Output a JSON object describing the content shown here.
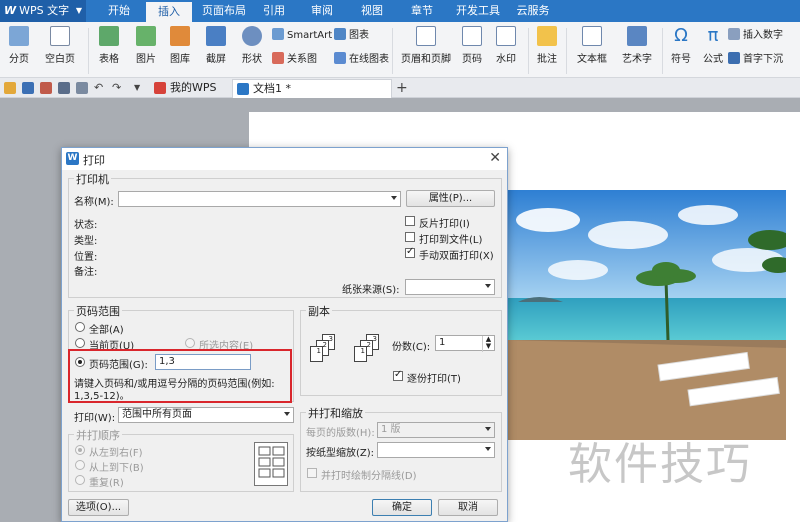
{
  "app": {
    "menu_label": "WPS 文字",
    "logo_glyph": "W",
    "tabs": [
      "开始",
      "插入",
      "页面布局",
      "引用",
      "审阅",
      "视图",
      "章节",
      "开发工具",
      "云服务"
    ],
    "active_tab": "插入"
  },
  "ribbon": {
    "page_break": "分页",
    "blank_page": "空白页",
    "table": "表格",
    "picture": "图片",
    "gallery": "图库",
    "screenshot": "截屏",
    "shapes": "形状",
    "smartart": "SmartArt",
    "chart": "图表",
    "relation": "关系图",
    "online_chart": "在线图表",
    "header_footer": "页眉和页脚",
    "page_number": "页码",
    "watermark": "水印",
    "comment": "批注",
    "textbox": "文本框",
    "wordart": "艺术字",
    "symbol": "符号",
    "formula": "公式",
    "insert_number": "插入数字",
    "drop_cap": "首字下沉"
  },
  "quickbar": {
    "doc_tabs": [
      "我的WPS",
      "文档1 *"
    ],
    "add_tab": "+"
  },
  "document": {
    "watermark_text": "软件技巧"
  },
  "dialog": {
    "title": "打印",
    "printer": {
      "legend": "打印机",
      "name_label": "名称(M):",
      "name_value": "",
      "properties_button": "属性(P)...",
      "status_label": "状态:",
      "type_label": "类型:",
      "location_label": "位置:",
      "comment_label": "备注:",
      "reverse_print": "反片打印(I)",
      "print_to_file": "打印到文件(L)",
      "manual_duplex": "手动双面打印(X)",
      "paper_source_label": "纸张来源(S):",
      "paper_source_value": ""
    },
    "page_range": {
      "legend": "页码范围",
      "all": "全部(A)",
      "current": "当前页(U)",
      "selection": "所选内容(E)",
      "pages": "页码范围(G):",
      "pages_value": "1,3",
      "hint_line1": "请键入页码和/或用逗号分隔的页码范围(例如:",
      "hint_line2": "1,3,5-12)。"
    },
    "print_what": {
      "label": "打印(W):",
      "value": "范围中所有页面"
    },
    "collate_order": {
      "legend": "并打顺序",
      "left_to_right": "从左到右(F)",
      "top_to_bottom": "从上到下(B)",
      "repeat": "重复(R)"
    },
    "copies": {
      "legend": "副本",
      "count_label": "份数(C):",
      "count_value": "1",
      "collate": "逐份打印(T)"
    },
    "zoom": {
      "legend": "并打和缩放",
      "pages_per_sheet_label": "每页的版数(H):",
      "pages_per_sheet_value": "1 版",
      "scale_label": "按纸型缩放(Z):",
      "scale_value": "",
      "draw_separator": "并打时绘制分隔线(D)"
    },
    "options_button": "选项(O)...",
    "ok_button": "确定",
    "cancel_button": "取消"
  },
  "colors": {
    "accent": "#2b77c5",
    "highlight": "#d9262c"
  }
}
